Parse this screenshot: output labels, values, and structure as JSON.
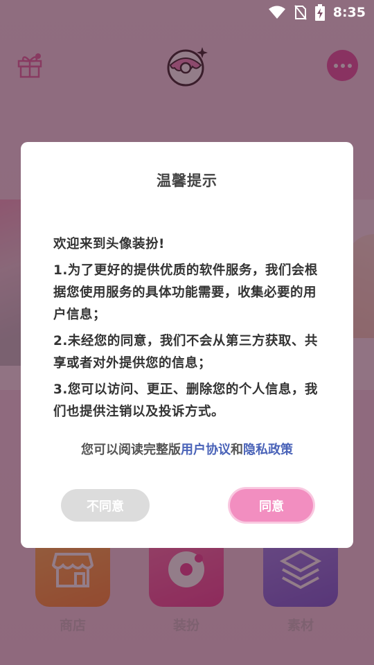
{
  "status_bar": {
    "time": "8:35",
    "icons": [
      "wifi-icon",
      "no-sim-icon",
      "battery-charging-icon"
    ]
  },
  "header": {
    "icons": [
      "gift-icon",
      "donut-logo-icon",
      "more-icon"
    ]
  },
  "bottom_nav": [
    {
      "label": "商店",
      "icon": "shop-icon"
    },
    {
      "label": "装扮",
      "icon": "donut-icon"
    },
    {
      "label": "素材",
      "icon": "layers-icon"
    }
  ],
  "dialog": {
    "title": "温馨提示",
    "welcome": "欢迎来到头像装扮!",
    "item1": "1.为了更好的提供优质的软件服务，我们会根据您使用服务的具体功能需要，收集必要的用户信息；",
    "item2": "2.未经您的同意，我们不会从第三方获取、共享或者对外提供您的信息；",
    "item3": "3.您可以访问、更正、删除您的个人信息，我们也提供注销以及投诉方式。",
    "read_prefix": "您可以阅读完整版",
    "user_agreement": "用户协议",
    "and": "和",
    "privacy_policy": "隐私政策",
    "disagree": "不同意",
    "agree": "同意"
  },
  "colors": {
    "accent": "#f28ec0",
    "link": "#4a63b8",
    "more_button": "#e85aa6"
  }
}
